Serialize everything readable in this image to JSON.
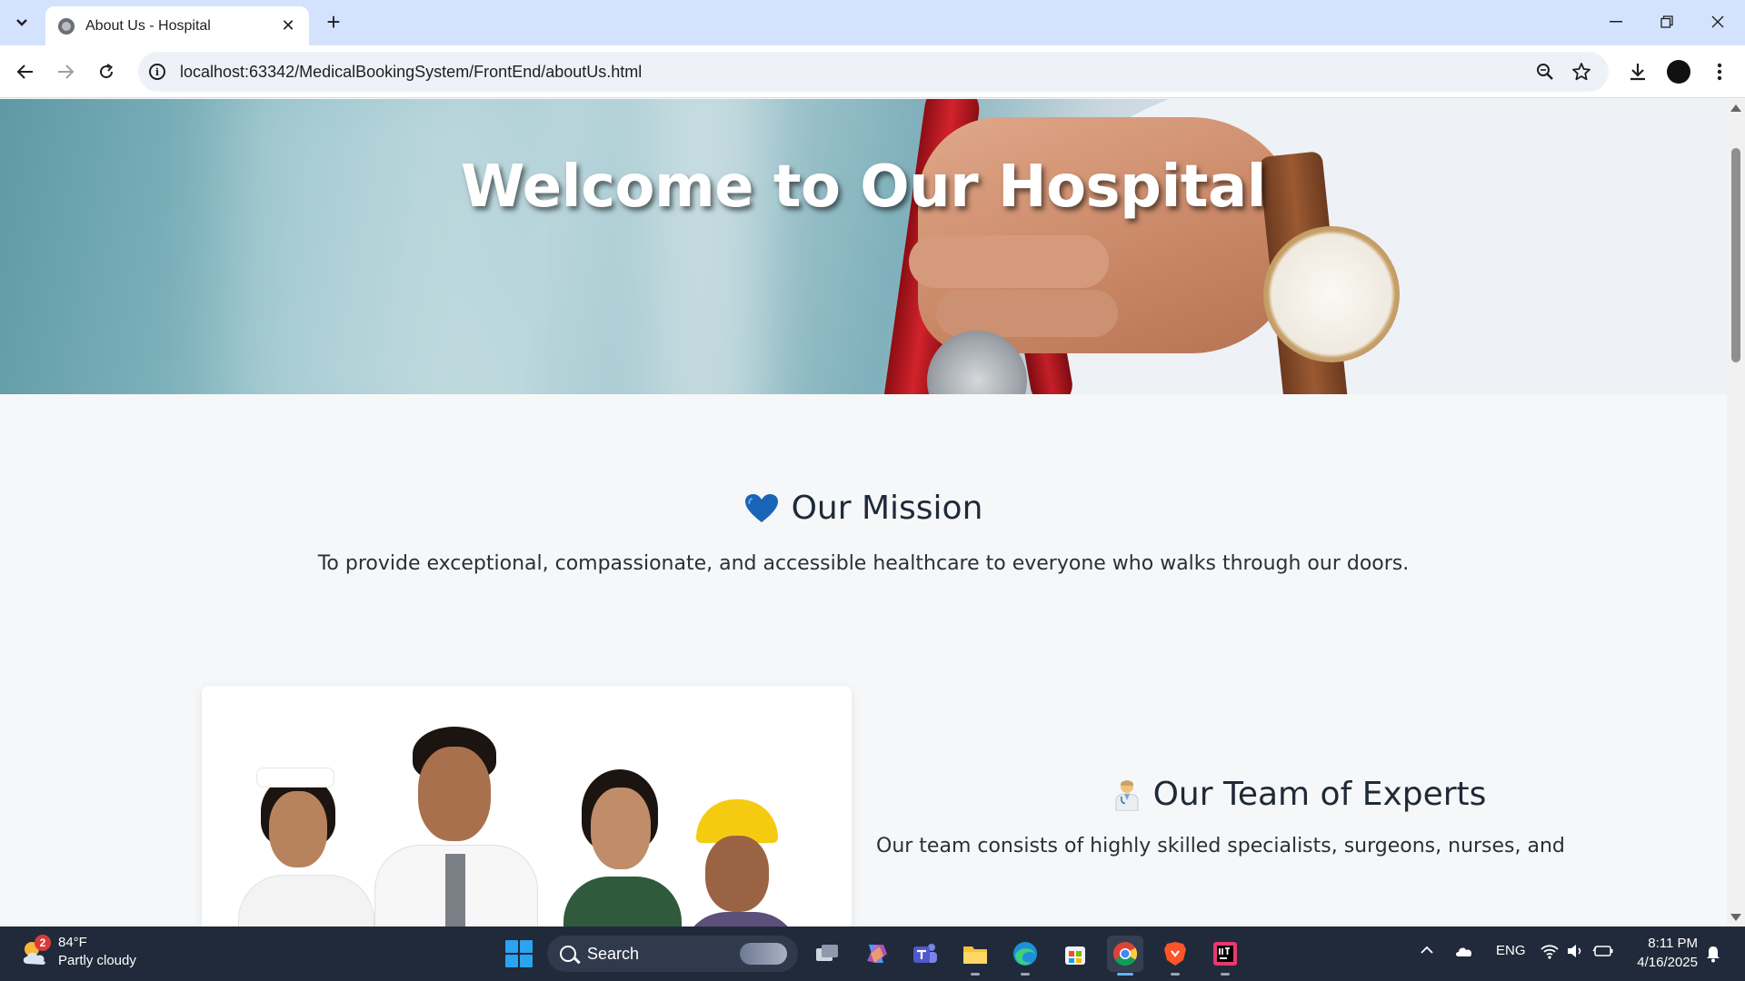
{
  "browser": {
    "tab_title": "About Us - Hospital",
    "url": "localhost:63342/MedicalBookingSystem/FrontEnd/aboutUs.html"
  },
  "page": {
    "hero_title": "Welcome to Our Hospital",
    "mission": {
      "title": "Our Mission",
      "text": "To provide exceptional, compassionate, and accessible healthcare to everyone who walks through our doors."
    },
    "team": {
      "title": "Our Team of Experts",
      "text": "Our team consists of highly skilled specialists, surgeons, nurses, and"
    }
  },
  "taskbar": {
    "weather_temp": "84°F",
    "weather_desc": "Partly cloudy",
    "weather_badge": "2",
    "search_label": "Search",
    "language": "ENG",
    "time": "8:11 PM",
    "date": "4/16/2025"
  },
  "colors": {
    "chrome_tab_bar": "#d3e3fd",
    "taskbar": "#202a3a",
    "heading": "#1f2a38"
  },
  "icons": {
    "mission_icon": "blue-heart-icon",
    "team_icon": "health-worker-icon"
  }
}
